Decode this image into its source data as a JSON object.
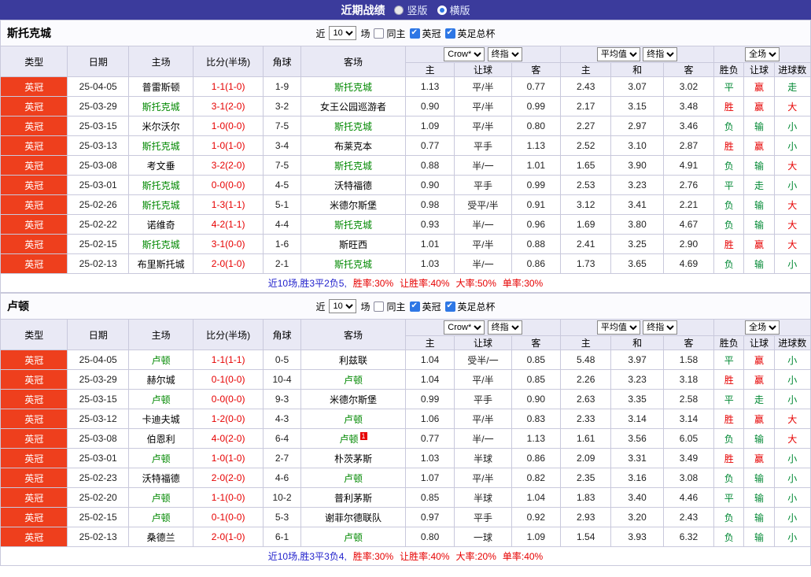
{
  "colors": {
    "topbar_bg": "#3b3b9c",
    "league_badge_bg": "#ee3f1d",
    "featured_team_green": "#008800",
    "score_red": "#e60000",
    "result_red": "#e60000",
    "result_green": "#008833",
    "header_bg": "#e9e9f5",
    "border": "#c9c9dc",
    "summary_blue": "#2222cc",
    "summary_red": "#e60000",
    "checkbox_blue": "#2e77e5"
  },
  "top_bar": {
    "title": "近期战绩",
    "layout_options": [
      {
        "label": "竖版",
        "selected": false
      },
      {
        "label": "横版",
        "selected": true
      }
    ]
  },
  "sections": [
    {
      "team": "斯托克城",
      "filter": {
        "prefix": "近",
        "count": "10",
        "suffix": "场",
        "checkboxes": [
          {
            "label": "同主",
            "checked": false
          },
          {
            "label": "英冠",
            "checked": true
          },
          {
            "label": "英足总杯",
            "checked": true
          }
        ]
      },
      "header": {
        "cols": [
          "类型",
          "日期",
          "主场",
          "比分(半场)",
          "角球",
          "客场"
        ],
        "odds_company": "Crow*",
        "odds_time": "终指",
        "avg_label": "平均值",
        "avg_time": "终指",
        "period_label": "全场",
        "sub": [
          "主",
          "让球",
          "客",
          "主",
          "和",
          "客",
          "胜负",
          "让球",
          "进球数"
        ]
      },
      "rows": [
        {
          "league": "英冠",
          "date": "25-04-05",
          "home": "普雷斯顿",
          "home_featured": false,
          "score": "1-1(1-0)",
          "corners": "1-9",
          "away": "斯托克城",
          "away_featured": true,
          "away_card": "",
          "odds": [
            "1.13",
            "平/半",
            "0.77"
          ],
          "avg": [
            "2.43",
            "3.07",
            "3.02"
          ],
          "results": [
            "平",
            "赢",
            "走"
          ],
          "result_colors": [
            "green",
            "red",
            "green"
          ]
        },
        {
          "league": "英冠",
          "date": "25-03-29",
          "home": "斯托克城",
          "home_featured": true,
          "score": "3-1(2-0)",
          "corners": "3-2",
          "away": "女王公园巡游者",
          "away_featured": false,
          "away_card": "",
          "odds": [
            "0.90",
            "平/半",
            "0.99"
          ],
          "avg": [
            "2.17",
            "3.15",
            "3.48"
          ],
          "results": [
            "胜",
            "赢",
            "大"
          ],
          "result_colors": [
            "red",
            "red",
            "red"
          ]
        },
        {
          "league": "英冠",
          "date": "25-03-15",
          "home": "米尔沃尔",
          "home_featured": false,
          "score": "1-0(0-0)",
          "corners": "7-5",
          "away": "斯托克城",
          "away_featured": true,
          "away_card": "",
          "odds": [
            "1.09",
            "平/半",
            "0.80"
          ],
          "avg": [
            "2.27",
            "2.97",
            "3.46"
          ],
          "results": [
            "负",
            "输",
            "小"
          ],
          "result_colors": [
            "green",
            "green",
            "green"
          ]
        },
        {
          "league": "英冠",
          "date": "25-03-13",
          "home": "斯托克城",
          "home_featured": true,
          "score": "1-0(1-0)",
          "corners": "3-4",
          "away": "布莱克本",
          "away_featured": false,
          "away_card": "",
          "odds": [
            "0.77",
            "平手",
            "1.13"
          ],
          "avg": [
            "2.52",
            "3.10",
            "2.87"
          ],
          "results": [
            "胜",
            "赢",
            "小"
          ],
          "result_colors": [
            "red",
            "red",
            "green"
          ]
        },
        {
          "league": "英冠",
          "date": "25-03-08",
          "home": "考文垂",
          "home_featured": false,
          "score": "3-2(2-0)",
          "corners": "7-5",
          "away": "斯托克城",
          "away_featured": true,
          "away_card": "",
          "odds": [
            "0.88",
            "半/一",
            "1.01"
          ],
          "avg": [
            "1.65",
            "3.90",
            "4.91"
          ],
          "results": [
            "负",
            "输",
            "大"
          ],
          "result_colors": [
            "green",
            "green",
            "red"
          ]
        },
        {
          "league": "英冠",
          "date": "25-03-01",
          "home": "斯托克城",
          "home_featured": true,
          "score": "0-0(0-0)",
          "corners": "4-5",
          "away": "沃特福德",
          "away_featured": false,
          "away_card": "",
          "odds": [
            "0.90",
            "平手",
            "0.99"
          ],
          "avg": [
            "2.53",
            "3.23",
            "2.76"
          ],
          "results": [
            "平",
            "走",
            "小"
          ],
          "result_colors": [
            "green",
            "green",
            "green"
          ]
        },
        {
          "league": "英冠",
          "date": "25-02-26",
          "home": "斯托克城",
          "home_featured": true,
          "score": "1-3(1-1)",
          "corners": "5-1",
          "away": "米德尔斯堡",
          "away_featured": false,
          "away_card": "",
          "odds": [
            "0.98",
            "受平/半",
            "0.91"
          ],
          "avg": [
            "3.12",
            "3.41",
            "2.21"
          ],
          "results": [
            "负",
            "输",
            "大"
          ],
          "result_colors": [
            "green",
            "green",
            "red"
          ]
        },
        {
          "league": "英冠",
          "date": "25-02-22",
          "home": "诺维奇",
          "home_featured": false,
          "score": "4-2(1-1)",
          "corners": "4-4",
          "away": "斯托克城",
          "away_featured": true,
          "away_card": "",
          "odds": [
            "0.93",
            "半/一",
            "0.96"
          ],
          "avg": [
            "1.69",
            "3.80",
            "4.67"
          ],
          "results": [
            "负",
            "输",
            "大"
          ],
          "result_colors": [
            "green",
            "green",
            "red"
          ]
        },
        {
          "league": "英冠",
          "date": "25-02-15",
          "home": "斯托克城",
          "home_featured": true,
          "score": "3-1(0-0)",
          "corners": "1-6",
          "away": "斯旺西",
          "away_featured": false,
          "away_card": "",
          "odds": [
            "1.01",
            "平/半",
            "0.88"
          ],
          "avg": [
            "2.41",
            "3.25",
            "2.90"
          ],
          "results": [
            "胜",
            "赢",
            "大"
          ],
          "result_colors": [
            "red",
            "red",
            "red"
          ]
        },
        {
          "league": "英冠",
          "date": "25-02-13",
          "home": "布里斯托城",
          "home_featured": false,
          "score": "2-0(1-0)",
          "corners": "2-1",
          "away": "斯托克城",
          "away_featured": true,
          "away_card": "",
          "odds": [
            "1.03",
            "半/一",
            "0.86"
          ],
          "avg": [
            "1.73",
            "3.65",
            "4.69"
          ],
          "results": [
            "负",
            "输",
            "小"
          ],
          "result_colors": [
            "green",
            "green",
            "green"
          ]
        }
      ],
      "summary": {
        "record": "近10场,胜3平2负5,",
        "win_rate": "胜率:30%",
        "handicap_rate": "让胜率:40%",
        "big_rate": "大率:50%",
        "odd_rate": "单率:30%"
      }
    },
    {
      "team": "卢顿",
      "filter": {
        "prefix": "近",
        "count": "10",
        "suffix": "场",
        "checkboxes": [
          {
            "label": "同主",
            "checked": false
          },
          {
            "label": "英冠",
            "checked": true
          },
          {
            "label": "英足总杯",
            "checked": true
          }
        ]
      },
      "header": {
        "cols": [
          "类型",
          "日期",
          "主场",
          "比分(半场)",
          "角球",
          "客场"
        ],
        "odds_company": "Crow*",
        "odds_time": "终指",
        "avg_label": "平均值",
        "avg_time": "终指",
        "period_label": "全场",
        "sub": [
          "主",
          "让球",
          "客",
          "主",
          "和",
          "客",
          "胜负",
          "让球",
          "进球数"
        ]
      },
      "rows": [
        {
          "league": "英冠",
          "date": "25-04-05",
          "home": "卢顿",
          "home_featured": true,
          "score": "1-1(1-1)",
          "corners": "0-5",
          "away": "利兹联",
          "away_featured": false,
          "away_card": "",
          "odds": [
            "1.04",
            "受半/一",
            "0.85"
          ],
          "avg": [
            "5.48",
            "3.97",
            "1.58"
          ],
          "results": [
            "平",
            "赢",
            "小"
          ],
          "result_colors": [
            "green",
            "red",
            "green"
          ]
        },
        {
          "league": "英冠",
          "date": "25-03-29",
          "home": "赫尔城",
          "home_featured": false,
          "score": "0-1(0-0)",
          "corners": "10-4",
          "away": "卢顿",
          "away_featured": true,
          "away_card": "",
          "odds": [
            "1.04",
            "平/半",
            "0.85"
          ],
          "avg": [
            "2.26",
            "3.23",
            "3.18"
          ],
          "results": [
            "胜",
            "赢",
            "小"
          ],
          "result_colors": [
            "red",
            "red",
            "green"
          ]
        },
        {
          "league": "英冠",
          "date": "25-03-15",
          "home": "卢顿",
          "home_featured": true,
          "score": "0-0(0-0)",
          "corners": "9-3",
          "away": "米德尔斯堡",
          "away_featured": false,
          "away_card": "",
          "odds": [
            "0.99",
            "平手",
            "0.90"
          ],
          "avg": [
            "2.63",
            "3.35",
            "2.58"
          ],
          "results": [
            "平",
            "走",
            "小"
          ],
          "result_colors": [
            "green",
            "green",
            "green"
          ]
        },
        {
          "league": "英冠",
          "date": "25-03-12",
          "home": "卡迪夫城",
          "home_featured": false,
          "score": "1-2(0-0)",
          "corners": "4-3",
          "away": "卢顿",
          "away_featured": true,
          "away_card": "",
          "odds": [
            "1.06",
            "平/半",
            "0.83"
          ],
          "avg": [
            "2.33",
            "3.14",
            "3.14"
          ],
          "results": [
            "胜",
            "赢",
            "大"
          ],
          "result_colors": [
            "red",
            "red",
            "red"
          ]
        },
        {
          "league": "英冠",
          "date": "25-03-08",
          "home": "伯恩利",
          "home_featured": false,
          "score": "4-0(2-0)",
          "corners": "6-4",
          "away": "卢顿",
          "away_featured": true,
          "away_card": "1",
          "odds": [
            "0.77",
            "半/一",
            "1.13"
          ],
          "avg": [
            "1.61",
            "3.56",
            "6.05"
          ],
          "results": [
            "负",
            "输",
            "大"
          ],
          "result_colors": [
            "green",
            "green",
            "red"
          ]
        },
        {
          "league": "英冠",
          "date": "25-03-01",
          "home": "卢顿",
          "home_featured": true,
          "score": "1-0(1-0)",
          "corners": "2-7",
          "away": "朴茨茅斯",
          "away_featured": false,
          "away_card": "",
          "odds": [
            "1.03",
            "半球",
            "0.86"
          ],
          "avg": [
            "2.09",
            "3.31",
            "3.49"
          ],
          "results": [
            "胜",
            "赢",
            "小"
          ],
          "result_colors": [
            "red",
            "red",
            "green"
          ]
        },
        {
          "league": "英冠",
          "date": "25-02-23",
          "home": "沃特福德",
          "home_featured": false,
          "score": "2-0(2-0)",
          "corners": "4-6",
          "away": "卢顿",
          "away_featured": true,
          "away_card": "",
          "odds": [
            "1.07",
            "平/半",
            "0.82"
          ],
          "avg": [
            "2.35",
            "3.16",
            "3.08"
          ],
          "results": [
            "负",
            "输",
            "小"
          ],
          "result_colors": [
            "green",
            "green",
            "green"
          ]
        },
        {
          "league": "英冠",
          "date": "25-02-20",
          "home": "卢顿",
          "home_featured": true,
          "score": "1-1(0-0)",
          "corners": "10-2",
          "away": "普利茅斯",
          "away_featured": false,
          "away_card": "",
          "odds": [
            "0.85",
            "半球",
            "1.04"
          ],
          "avg": [
            "1.83",
            "3.40",
            "4.46"
          ],
          "results": [
            "平",
            "输",
            "小"
          ],
          "result_colors": [
            "green",
            "green",
            "green"
          ]
        },
        {
          "league": "英冠",
          "date": "25-02-15",
          "home": "卢顿",
          "home_featured": true,
          "score": "0-1(0-0)",
          "corners": "5-3",
          "away": "谢菲尔德联队",
          "away_featured": false,
          "away_card": "",
          "odds": [
            "0.97",
            "平手",
            "0.92"
          ],
          "avg": [
            "2.93",
            "3.20",
            "2.43"
          ],
          "results": [
            "负",
            "输",
            "小"
          ],
          "result_colors": [
            "green",
            "green",
            "green"
          ]
        },
        {
          "league": "英冠",
          "date": "25-02-13",
          "home": "桑德兰",
          "home_featured": false,
          "score": "2-0(1-0)",
          "corners": "6-1",
          "away": "卢顿",
          "away_featured": true,
          "away_card": "",
          "odds": [
            "0.80",
            "一球",
            "1.09"
          ],
          "avg": [
            "1.54",
            "3.93",
            "6.32"
          ],
          "results": [
            "负",
            "输",
            "小"
          ],
          "result_colors": [
            "green",
            "green",
            "green"
          ]
        }
      ],
      "summary": {
        "record": "近10场,胜3平3负4,",
        "win_rate": "胜率:30%",
        "handicap_rate": "让胜率:40%",
        "big_rate": "大率:20%",
        "odd_rate": "单率:40%"
      }
    }
  ]
}
